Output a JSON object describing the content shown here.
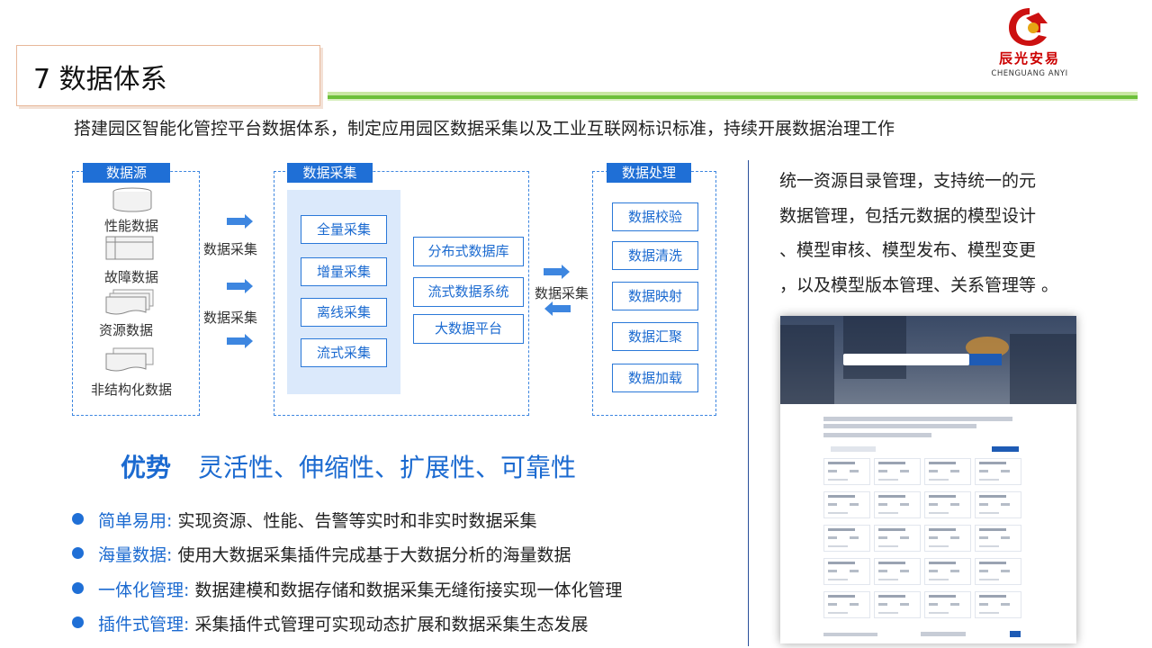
{
  "slide": {
    "title": "7 数据体系",
    "subtitle": "搭建园区智能化管控平台数据体系，制定应用园区数据采集以及工业互联网标识标准，持续开展数据治理工作"
  },
  "logo": {
    "name_cn": "辰光安易",
    "name_en": "CHENGUANG ANYI",
    "colors": {
      "red": "#cc1111",
      "gold": "#e6a514"
    }
  },
  "diagram": {
    "source": {
      "tag": "数据源",
      "items": [
        "性能数据",
        "故障数据",
        "资源数据",
        "非结构化数据"
      ]
    },
    "flow_label_1": "数据采集",
    "flow_label_2": "数据采集",
    "collect": {
      "tag": "数据采集",
      "methods": [
        "全量采集",
        "增量采集",
        "离线采集",
        "流式采集"
      ],
      "systems": [
        "分布式数据库",
        "流式数据系统",
        "大数据平台"
      ]
    },
    "flow_label_3": "数据采集",
    "process": {
      "tag": "数据处理",
      "items": [
        "数据校验",
        "数据清洗",
        "数据映射",
        "数据汇聚",
        "数据加载"
      ]
    }
  },
  "advantage": {
    "label": "优势",
    "text": "灵活性、伸缩性、扩展性、可靠性"
  },
  "bullets": [
    {
      "head": "简单易用:",
      "text": " 实现资源、性能、告警等实时和非实时数据采集"
    },
    {
      "head": "海量数据:",
      "text": " 使用大数据采集插件完成基于大数据分析的海量数据"
    },
    {
      "head": "一体化管理:",
      "text": " 数据建模和数据存储和数据采集无缝衔接实现一体化管理"
    },
    {
      "head": "插件式管理:",
      "text": " 采集插件式管理可实现动态扩展和数据采集生态发展"
    }
  ],
  "right_text": {
    "lines": [
      "统一资源目录管理，支持统一的元",
      "数据管理，包括元数据的模型设计",
      "、模型审核、模型发布、模型变更",
      "，以及模型版本管理、关系管理等 。"
    ]
  },
  "theme": {
    "accent": "#1f6fd6",
    "panel": "#dbe9fb",
    "green": "#6cbf3a"
  }
}
